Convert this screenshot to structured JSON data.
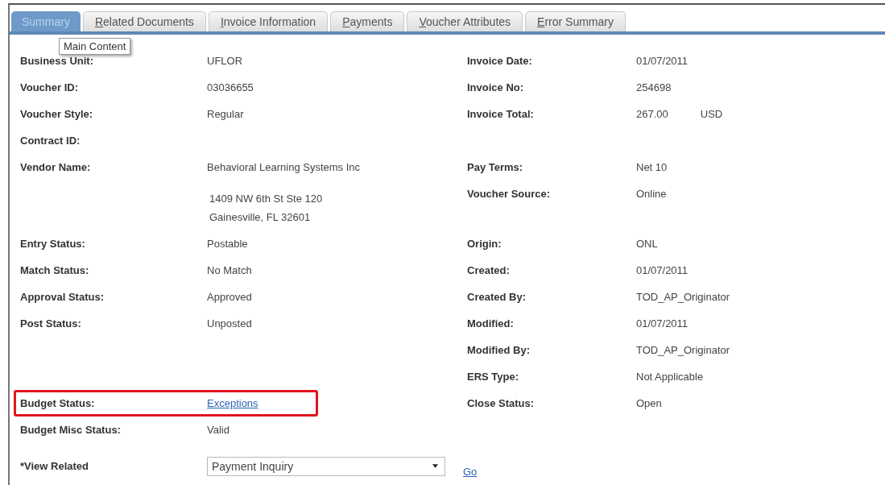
{
  "tabs": [
    {
      "label": "Summary",
      "selected": true,
      "access_key_underlined": false
    },
    {
      "label": "Related Documents",
      "selected": false,
      "access_key_underlined": true
    },
    {
      "label": "Invoice Information",
      "selected": false,
      "access_key_underlined": true
    },
    {
      "label": "Payments",
      "selected": false,
      "access_key_underlined": true
    },
    {
      "label": "Voucher Attributes",
      "selected": false,
      "access_key_underlined": true
    },
    {
      "label": "Error Summary",
      "selected": false,
      "access_key_underlined": true
    }
  ],
  "tooltip": {
    "text": "Main Content"
  },
  "rows": [
    {
      "left": {
        "label": "Business Unit:",
        "kind": "text",
        "value": "UFLOR"
      },
      "right": {
        "label": "Invoice Date:",
        "kind": "text",
        "value": "01/07/2011"
      }
    },
    {
      "left": {
        "label": "Voucher ID:",
        "kind": "text",
        "value": "03036655"
      },
      "right": {
        "label": "Invoice No:",
        "kind": "text",
        "value": "254698"
      }
    },
    {
      "left": {
        "label": "Voucher Style:",
        "kind": "text",
        "value": "Regular"
      },
      "right": {
        "label": "Invoice Total:",
        "kind": "amount",
        "value": "267.00",
        "currency": "USD"
      }
    },
    {
      "left": {
        "label": "Contract ID:",
        "kind": "text"
      }
    },
    {
      "left": {
        "label": "Vendor Name:",
        "kind": "text",
        "value": "Behavioral Learning Systems Inc"
      },
      "right": {
        "label": "Pay Terms:",
        "kind": "text",
        "value": "Net 10"
      }
    },
    {
      "left": {
        "kind": "address",
        "lines": [
          "1409 NW 6th St  Ste 120",
          "Gainesville, FL  32601"
        ]
      },
      "right": {
        "label": "Voucher Source:",
        "kind": "text",
        "value": "Online"
      }
    },
    {
      "left": {
        "label": "Entry Status:",
        "kind": "text",
        "value": "Postable"
      },
      "right": {
        "label": "Origin:",
        "kind": "text",
        "value": "ONL"
      }
    },
    {
      "left": {
        "label": "Match Status:",
        "kind": "text",
        "value": "No Match"
      },
      "right": {
        "label": "Created:",
        "kind": "text",
        "value": "01/07/2011"
      }
    },
    {
      "left": {
        "label": "Approval Status:",
        "kind": "text",
        "value": "Approved"
      },
      "right": {
        "label": "Created By:",
        "kind": "text",
        "value": "TOD_AP_Originator"
      }
    },
    {
      "left": {
        "label": "Post Status:",
        "kind": "text",
        "value": "Unposted"
      },
      "right": {
        "label": "Modified:",
        "kind": "text",
        "value": "01/07/2011"
      }
    },
    {
      "right": {
        "label": "Modified By:",
        "kind": "text",
        "value": "TOD_AP_Originator"
      }
    },
    {
      "right": {
        "label": "ERS Type:",
        "kind": "text",
        "value": "Not Applicable"
      }
    },
    {
      "left": {
        "label": "Budget Status:",
        "kind": "link",
        "value": "Exceptions",
        "highlighted": true
      },
      "right": {
        "label": "Close Status:",
        "kind": "text",
        "value": "Open"
      }
    },
    {
      "left": {
        "label": "Budget Misc Status:",
        "kind": "text",
        "value": "Valid"
      }
    }
  ],
  "view_related": {
    "label": "*View Related",
    "value": "Payment Inquiry",
    "go_link": "Go"
  }
}
